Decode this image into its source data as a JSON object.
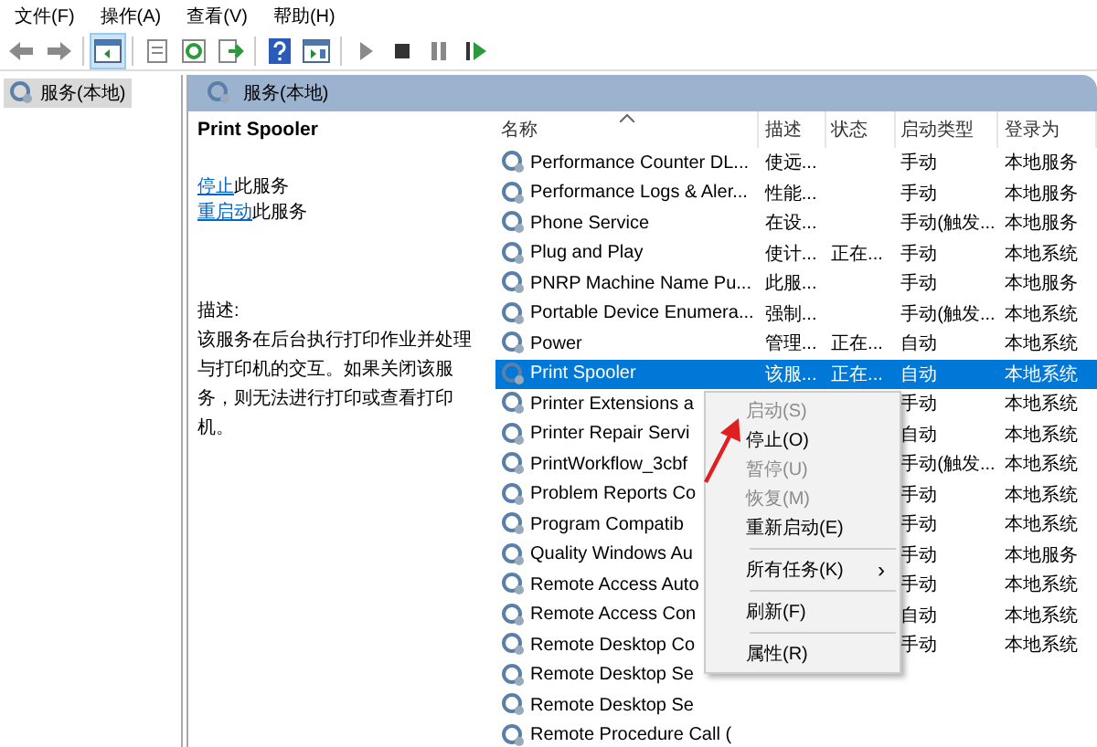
{
  "menu_bar": [
    "文件(F)",
    "操作(A)",
    "查看(V)",
    "帮助(H)"
  ],
  "toolbar": [
    {
      "kind": "back",
      "selected": false
    },
    {
      "kind": "forward",
      "selected": false
    },
    {
      "kind": "sep"
    },
    {
      "kind": "tree",
      "selected": true
    },
    {
      "kind": "sep"
    },
    {
      "kind": "props",
      "selected": false
    },
    {
      "kind": "refresh",
      "selected": false
    },
    {
      "kind": "export",
      "selected": false
    },
    {
      "kind": "sep"
    },
    {
      "kind": "help",
      "selected": false
    },
    {
      "kind": "console",
      "selected": false
    },
    {
      "kind": "sep"
    },
    {
      "kind": "play",
      "selected": false
    },
    {
      "kind": "stop",
      "selected": false
    },
    {
      "kind": "pause",
      "selected": false
    },
    {
      "kind": "resume",
      "selected": false
    }
  ],
  "tree": {
    "items": [
      {
        "label": "服务(本地)",
        "selected": true
      }
    ]
  },
  "pane_header": "服务(本地)",
  "details": {
    "title": "Print Spooler",
    "actions": [
      {
        "link": "停止",
        "rest": "此服务"
      },
      {
        "link": "重启动",
        "rest": "此服务"
      }
    ],
    "description_label": "描述:",
    "description": "该服务在后台执行打印作业并处理与打印机的交互。如果关闭该服务，则无法进行打印或查看打印机。"
  },
  "table": {
    "columns": [
      "名称",
      "描述",
      "状态",
      "启动类型",
      "登录为"
    ],
    "rows": [
      {
        "name": "Performance Counter DL...",
        "desc": "使远...",
        "status": "",
        "startup": "手动",
        "logon": "本地服务",
        "selected": false
      },
      {
        "name": "Performance Logs & Aler...",
        "desc": "性能...",
        "status": "",
        "startup": "手动",
        "logon": "本地服务",
        "selected": false
      },
      {
        "name": "Phone Service",
        "desc": "在设...",
        "status": "",
        "startup": "手动(触发...",
        "logon": "本地服务",
        "selected": false
      },
      {
        "name": "Plug and Play",
        "desc": "使计...",
        "status": "正在...",
        "startup": "手动",
        "logon": "本地系统",
        "selected": false
      },
      {
        "name": "PNRP Machine Name Pu...",
        "desc": "此服...",
        "status": "",
        "startup": "手动",
        "logon": "本地服务",
        "selected": false
      },
      {
        "name": "Portable Device Enumera...",
        "desc": "强制...",
        "status": "",
        "startup": "手动(触发...",
        "logon": "本地系统",
        "selected": false
      },
      {
        "name": "Power",
        "desc": "管理...",
        "status": "正在...",
        "startup": "自动",
        "logon": "本地系统",
        "selected": false
      },
      {
        "name": "Print Spooler",
        "desc": "该服...",
        "status": "正在...",
        "startup": "自动",
        "logon": "本地系统",
        "selected": true
      },
      {
        "name": "Printer Extensions a",
        "desc": "",
        "status": "",
        "startup": "手动",
        "logon": "本地系统",
        "selected": false
      },
      {
        "name": "Printer Repair Servi",
        "desc": "",
        "status": "",
        "startup": "自动",
        "logon": "本地系统",
        "selected": false
      },
      {
        "name": "PrintWorkflow_3cbf",
        "desc": "",
        "status": "",
        "startup": "手动(触发...",
        "logon": "本地系统",
        "selected": false
      },
      {
        "name": "Problem Reports Co",
        "desc": "",
        "status": "",
        "startup": "手动",
        "logon": "本地系统",
        "selected": false
      },
      {
        "name": "Program Compatib",
        "desc": "",
        "status": "",
        "startup": "手动",
        "logon": "本地系统",
        "selected": false
      },
      {
        "name": "Quality Windows Au",
        "desc": "",
        "status": "",
        "startup": "手动",
        "logon": "本地服务",
        "selected": false
      },
      {
        "name": "Remote Access Auto",
        "desc": "",
        "status": "",
        "startup": "手动",
        "logon": "本地系统",
        "selected": false
      },
      {
        "name": "Remote Access Con",
        "desc": "",
        "status": "",
        "startup": "自动",
        "logon": "本地系统",
        "selected": false
      },
      {
        "name": "Remote Desktop Co",
        "desc": "",
        "status": "",
        "startup": "手动",
        "logon": "本地系统",
        "selected": false
      },
      {
        "name": "Remote Desktop Se",
        "desc": "",
        "status": "",
        "startup": "",
        "logon": "",
        "selected": false
      },
      {
        "name": "Remote Desktop Se",
        "desc": "",
        "status": "",
        "startup": "",
        "logon": "",
        "selected": false
      },
      {
        "name": "Remote Procedure Call (",
        "desc": "",
        "status": "",
        "startup": "",
        "logon": "",
        "selected": false
      }
    ]
  },
  "context_menu": [
    {
      "kind": "item",
      "label": "启动(S)",
      "disabled": true
    },
    {
      "kind": "item",
      "label": "停止(O)",
      "disabled": false
    },
    {
      "kind": "item",
      "label": "暂停(U)",
      "disabled": true
    },
    {
      "kind": "item",
      "label": "恢复(M)",
      "disabled": true
    },
    {
      "kind": "item",
      "label": "重新启动(E)",
      "disabled": false
    },
    {
      "kind": "sep"
    },
    {
      "kind": "submenu",
      "label": "所有任务(K)",
      "arrow": "›",
      "disabled": false
    },
    {
      "kind": "sep"
    },
    {
      "kind": "item",
      "label": "刷新(F)",
      "disabled": false
    },
    {
      "kind": "sep"
    },
    {
      "kind": "item",
      "label": "属性(R)",
      "disabled": false
    }
  ]
}
